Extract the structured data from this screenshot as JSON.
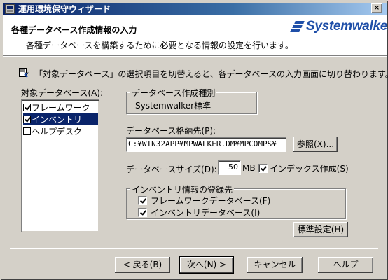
{
  "window": {
    "title": "運用環境保守ウィザード",
    "close_glyph": "×"
  },
  "header": {
    "title": "各種データベース作成情報の入力",
    "subtitle": "各種データベースを構築するために必要となる情報の設定を行います。",
    "logo_text": "Systemwalker",
    "logo_color": "#1f4fa8"
  },
  "info": {
    "icon": "info-document-icon",
    "text": "「対象データベース」の選択項目を切替えると、各データベースの入力画面に切り替わります。"
  },
  "target_db": {
    "label": "対象データベース(A):",
    "items": [
      {
        "label": "フレームワーク",
        "checked": true,
        "selected": false
      },
      {
        "label": "インベントリ",
        "checked": true,
        "selected": true
      },
      {
        "label": "ヘルプデスク",
        "checked": false,
        "selected": false
      }
    ]
  },
  "db_type": {
    "title": "データベース作成種別",
    "value": "Systemwalker標準"
  },
  "db_location": {
    "label": "データベース格納先(P):",
    "value": "C:¥WIN32APP¥MPWALKER.DM¥MPCOMPS¥",
    "browse_label": "参照(X)..."
  },
  "db_size": {
    "label": "データベースサイズ(D):",
    "value": "50",
    "unit": "MB",
    "index_label": "インデックス作成(S)",
    "index_checked": true
  },
  "inventory_reg": {
    "title": "インベントリ情報の登録先",
    "options": [
      {
        "label": "フレームワークデータベース(F)",
        "checked": true
      },
      {
        "label": "インベントリデータベース(I)",
        "checked": true
      }
    ],
    "default_button": "標準設定(H)"
  },
  "footer": {
    "back": "< 戻る(B)",
    "next": "次へ(N) >",
    "cancel": "キャンセル",
    "help": "ヘルプ"
  }
}
